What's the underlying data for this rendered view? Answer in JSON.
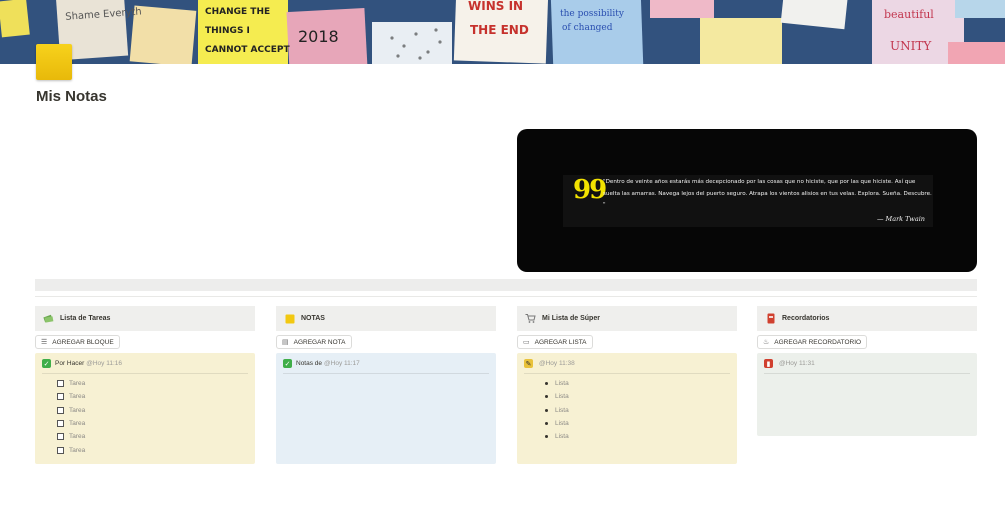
{
  "page": {
    "title": "Mis Notas",
    "icon": "yellow-sticky-note-icon"
  },
  "cover": {
    "notes": [
      "Shame Everyth",
      "CHANGE THE THINGS I CANNOT ACCEPT",
      "2018",
      "WINS IN THE END",
      "the possibility of changed",
      "beautiful",
      "UNITY"
    ]
  },
  "quote": {
    "text": "\"Dentro de veinte años estarás más decepcionado por las cosas que no hiciste, que por las que hiciste. Así que suelta las amarras. Navega lejos del puerto seguro. Atrapa los vientos alisios en tus velas. Explora. Sueña. Descubre. \"",
    "author": "— Mark Twain"
  },
  "columns": [
    {
      "header": "Lista de Tareas",
      "header_icon": "money-stack-icon",
      "button": "AGREGAR BLOQUE",
      "button_icon": "list-icon",
      "card_bg": "#f7f1d3",
      "card": {
        "icon": "green-check-icon",
        "label": "Por Hacer",
        "date": "@Hoy 11:16",
        "item_type": "checkbox",
        "items": [
          "Tarea",
          "Tarea",
          "Tarea",
          "Tarea",
          "Tarea",
          "Tarea"
        ]
      }
    },
    {
      "header": "NOTAS",
      "header_icon": "yellow-note-icon",
      "button": "AGREGAR NOTA",
      "button_icon": "note-icon",
      "card_bg": "#e6eff6",
      "card": {
        "icon": "green-check-icon",
        "label": "Notas de",
        "date": "@Hoy 11:17",
        "item_type": "none",
        "items": []
      }
    },
    {
      "header": "Mi Lista de Súper",
      "header_icon": "shopping-cart-icon",
      "button": "AGREGAR LISTA",
      "button_icon": "page-icon",
      "card_bg": "#f7f1d3",
      "card": {
        "icon": "pencil-paper-icon",
        "label": "",
        "date": "@Hoy 11:38",
        "item_type": "bullet",
        "items": [
          "Lista",
          "Lista",
          "Lista",
          "Lista",
          "Lista"
        ]
      }
    },
    {
      "header": "Recordatorios",
      "header_icon": "red-notebook-icon",
      "button": "AGREGAR RECORDATORIO",
      "button_icon": "bell-icon",
      "card_bg": "#ecf0eb",
      "card": {
        "icon": "red-notebook-icon",
        "label": "",
        "date": "@Hoy 11:31",
        "item_type": "none",
        "items": []
      }
    }
  ]
}
